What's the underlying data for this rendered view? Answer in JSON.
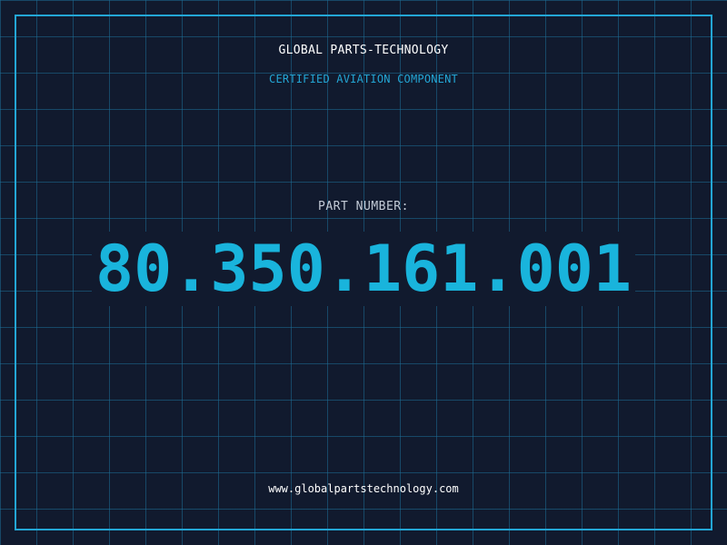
{
  "header": {
    "company_name": "GLOBAL PARTS-TECHNOLOGY",
    "tagline": "CERTIFIED AVIATION COMPONENT"
  },
  "part": {
    "label": "PART NUMBER:",
    "number": "80.350.161.001"
  },
  "footer": {
    "website": "www.globalpartstechnology.com"
  },
  "colors": {
    "background": "#111a2e",
    "grid": "#1c6e96",
    "accent": "#23a6d5",
    "part_number": "#19b4dc",
    "text": "#ffffff"
  }
}
